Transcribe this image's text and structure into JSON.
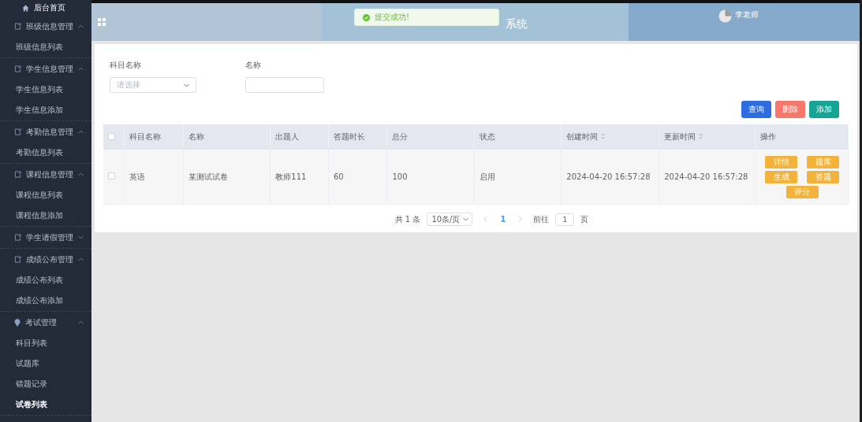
{
  "sidebar": {
    "home": {
      "label": "后台首页"
    },
    "groups": [
      {
        "label": "班级信息管理",
        "kind": "doc",
        "expanded": true,
        "items": [
          {
            "label": "班级信息列表",
            "selected": false
          }
        ]
      },
      {
        "label": "学生信息管理",
        "kind": "doc",
        "expanded": true,
        "items": [
          {
            "label": "学生信息列表",
            "selected": false
          },
          {
            "label": "学生信息添加",
            "selected": false
          }
        ]
      },
      {
        "label": "考勤信息管理",
        "kind": "doc",
        "expanded": true,
        "items": [
          {
            "label": "考勤信息列表",
            "selected": false
          }
        ]
      },
      {
        "label": "课程信息管理",
        "kind": "doc",
        "expanded": true,
        "items": [
          {
            "label": "课程信息列表",
            "selected": false
          },
          {
            "label": "课程信息添加",
            "selected": false
          }
        ]
      },
      {
        "label": "学生请假管理",
        "kind": "doc",
        "expanded": false
      },
      {
        "label": "成绩公布管理",
        "kind": "doc",
        "expanded": true,
        "items": [
          {
            "label": "成绩公布列表",
            "selected": false
          },
          {
            "label": "成绩公布添加",
            "selected": false
          }
        ]
      },
      {
        "label": "考试管理",
        "kind": "pin",
        "expanded": true,
        "items": [
          {
            "label": "科目列表",
            "selected": false
          },
          {
            "label": "试题库",
            "selected": false
          },
          {
            "label": "错题记录",
            "selected": false
          },
          {
            "label": "试卷列表",
            "selected": true
          }
        ]
      }
    ]
  },
  "header": {
    "title": "系统",
    "user": "李老师"
  },
  "toast": {
    "message": "提交成功!"
  },
  "filters": [
    {
      "label": "科目名称",
      "kind": "select",
      "placeholder": "请选择"
    },
    {
      "label": "名称",
      "kind": "text"
    }
  ],
  "actions": [
    {
      "label": "查询",
      "color": "#2e6de0"
    },
    {
      "label": "删除",
      "color": "#f7776a"
    },
    {
      "label": "添加",
      "color": "#14a595"
    }
  ],
  "table": {
    "header_checked": false,
    "columns": [
      {
        "label": "科目名称",
        "sortable": false
      },
      {
        "label": "名称",
        "sortable": false
      },
      {
        "label": "出题人",
        "sortable": false
      },
      {
        "label": "答题时长",
        "sortable": false
      },
      {
        "label": "总分",
        "sortable": false
      },
      {
        "label": "状态",
        "sortable": false
      },
      {
        "label": "创建时间",
        "sortable": true
      },
      {
        "label": "更新时间",
        "sortable": true
      },
      {
        "label": "操作",
        "sortable": false
      }
    ],
    "rows": [
      {
        "checked": false,
        "cells": [
          "英语",
          "某测试试卷",
          "教师111",
          "60",
          "100",
          "启用",
          "2024-04-20 16:57:28",
          "2024-04-20 16:57:28"
        ],
        "actions": [
          "详情",
          "题库",
          "生成",
          "答题",
          "评分"
        ]
      }
    ]
  },
  "pagination": {
    "total": "共 1 条",
    "page_size": "10条/页",
    "pages": [
      {
        "label": "1",
        "selected": true
      }
    ],
    "goto_label": "前往",
    "goto_value": "1",
    "goto_suffix": "页"
  }
}
